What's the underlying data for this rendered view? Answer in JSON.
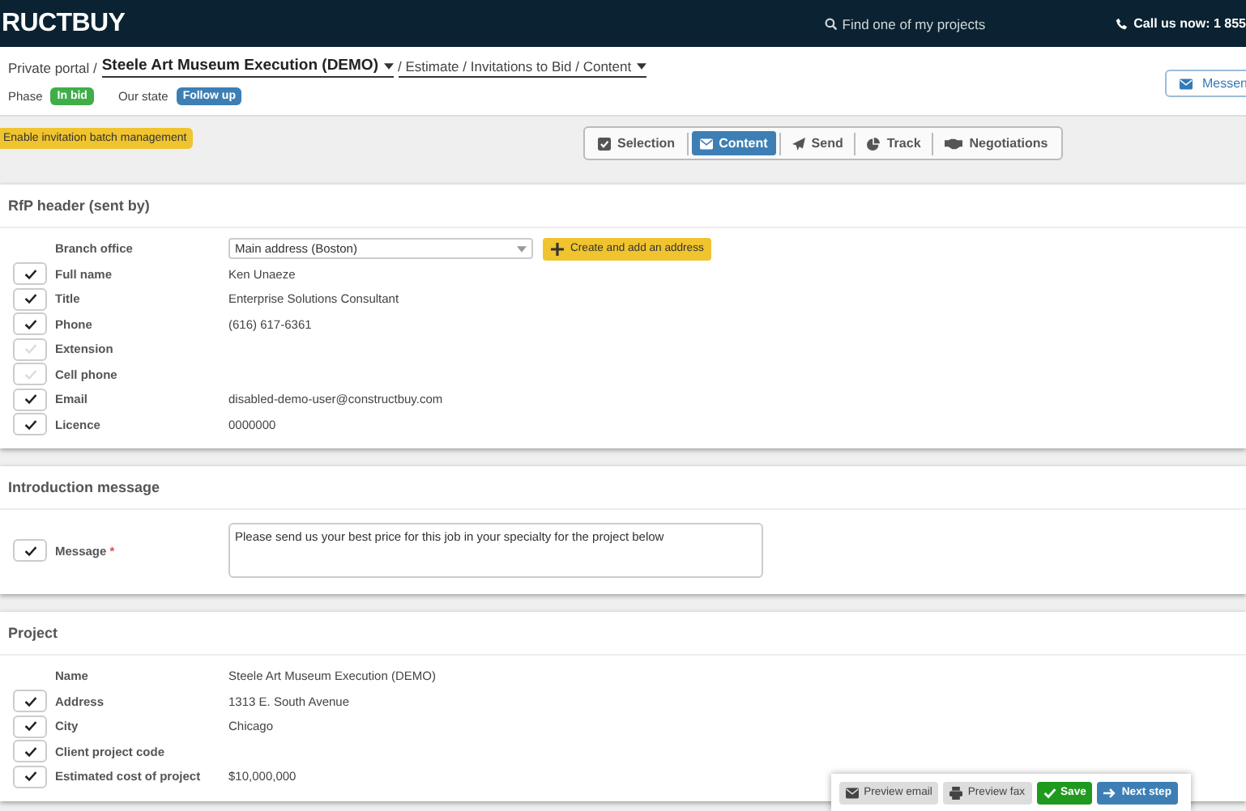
{
  "header": {
    "logo": "RUCTBUY",
    "search_placeholder": "Find one of my projects",
    "call": "Call us now: 1 855"
  },
  "breadcrumb": {
    "prefix": "Private portal /",
    "project": "Steele Art Museum Execution (DEMO)",
    "path": "/ Estimate / Invitations to Bid / Content"
  },
  "phase": {
    "label": "Phase",
    "badge": "In bid"
  },
  "state": {
    "label": "Our state",
    "badge": "Follow up"
  },
  "messenger_button": "Messen",
  "batch_button": "Enable invitation batch management",
  "tabs": [
    {
      "label": "Selection",
      "kind": "check",
      "selected": false
    },
    {
      "label": "Content",
      "kind": "envelope",
      "selected": true
    },
    {
      "label": "Send",
      "kind": "plane",
      "selected": false
    },
    {
      "label": "Track",
      "kind": "pie",
      "selected": false
    },
    {
      "label": "Negotiations",
      "kind": "hands",
      "selected": false
    }
  ],
  "sections": [
    {
      "title": "RfP header (sent by)",
      "rows": [
        {
          "kind": "select",
          "label": "Branch office",
          "value": "Main address (Boston)",
          "button": "Create and add an address"
        },
        {
          "kind": "field",
          "label": "Full name",
          "value": "Ken Unaeze",
          "checked": true
        },
        {
          "kind": "field",
          "label": "Title",
          "value": "Enterprise Solutions Consultant",
          "checked": true
        },
        {
          "kind": "field",
          "label": "Phone",
          "value": "(616) 617-6361",
          "checked": true
        },
        {
          "kind": "field",
          "label": "Extension",
          "checked": false
        },
        {
          "kind": "field",
          "label": "Cell phone",
          "checked": false
        },
        {
          "kind": "field",
          "label": "Email",
          "value": "disabled-demo-user@constructbuy.com",
          "checked": true
        },
        {
          "kind": "field",
          "label": "Licence",
          "value": "0000000",
          "checked": true
        }
      ]
    },
    {
      "title": "Introduction message",
      "rows": [
        {
          "kind": "textarea",
          "label": "Message",
          "required_mark": "*",
          "value": "Please send us your best price for this job in your specialty for the project below",
          "checked": true
        }
      ]
    },
    {
      "title": "Project",
      "rows": [
        {
          "kind": "plain",
          "label": "Name",
          "value": "Steele Art Museum Execution (DEMO)"
        },
        {
          "kind": "field",
          "label": "Address",
          "value": "1313 E. South Avenue",
          "checked": true
        },
        {
          "kind": "field",
          "label": "City",
          "value": "Chicago",
          "checked": true
        },
        {
          "kind": "field",
          "label": "Client project code",
          "checked": true
        },
        {
          "kind": "field",
          "label": "Estimated cost of project",
          "value": "$10,000,000",
          "checked": true
        }
      ]
    }
  ],
  "actions": [
    {
      "label": "Preview email",
      "kind": "email"
    },
    {
      "label": "Preview fax",
      "kind": "fax"
    },
    {
      "label": "Save",
      "kind": "save"
    },
    {
      "label": "Next step",
      "kind": "next"
    }
  ]
}
